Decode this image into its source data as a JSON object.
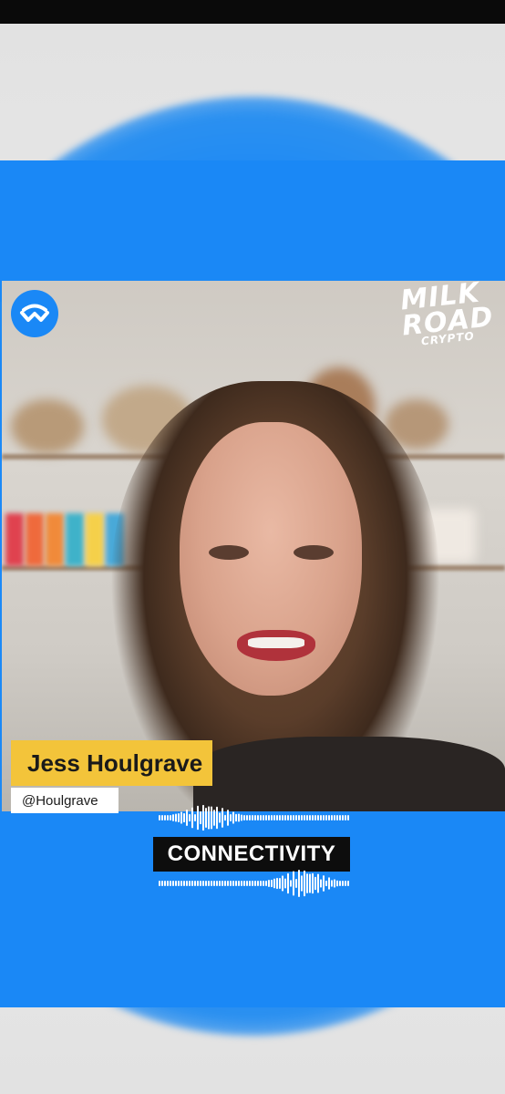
{
  "video": {
    "speaker_name": "Jess Houlgrave",
    "speaker_handle": "@Houlgrave",
    "topic_title": "CONNECTIVITY",
    "brand": {
      "line1": "MILK",
      "line2": "ROAD",
      "line3": "CRYPTO"
    },
    "badge_icon": "walletconnect-logo-icon"
  },
  "colors": {
    "accent_blue": "#1a88f6",
    "name_plate": "#f3c43a",
    "title_bg": "#0d0d0d"
  }
}
